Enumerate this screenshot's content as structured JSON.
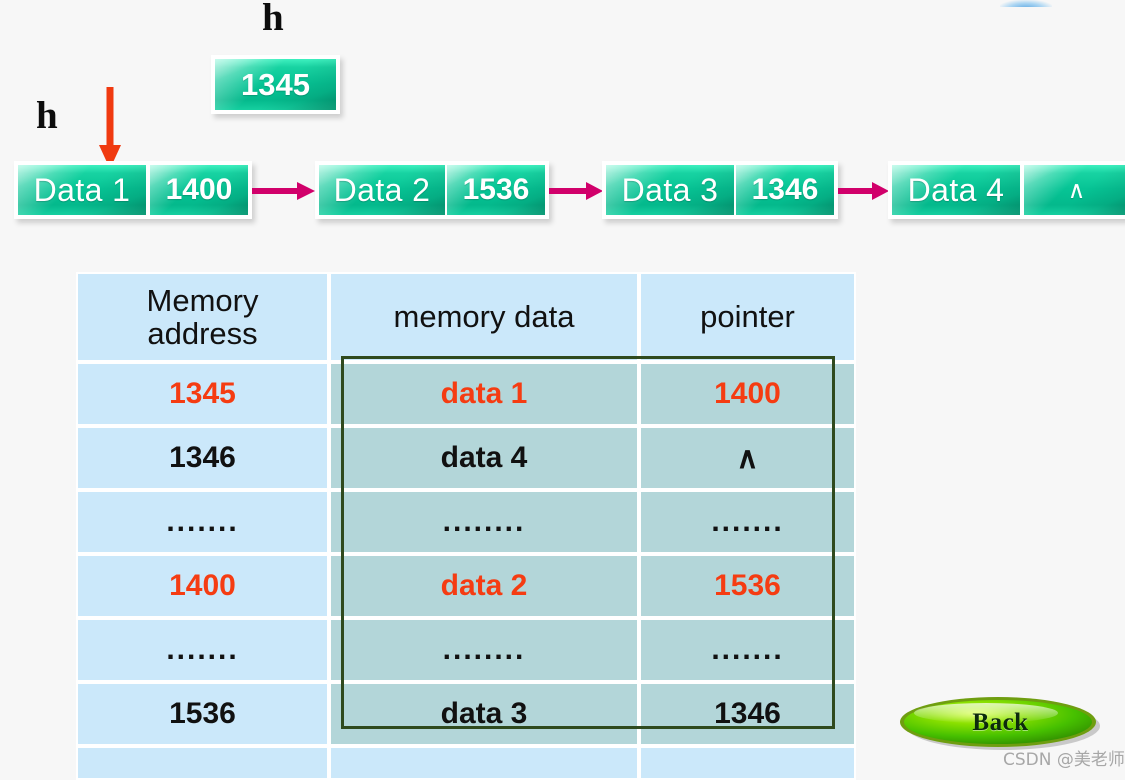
{
  "pointers": {
    "head_label_top": "h",
    "head_label_left": "h"
  },
  "head_box": {
    "value": "1345"
  },
  "linked_list": {
    "nodes": [
      {
        "data": "Data 1",
        "pointer": "1400"
      },
      {
        "data": "Data 2",
        "pointer": "1536"
      },
      {
        "data": "Data 3",
        "pointer": "1346"
      },
      {
        "data": "Data 4",
        "pointer": "∧"
      }
    ]
  },
  "table": {
    "headers": [
      "Memory address",
      "memory data",
      "pointer"
    ],
    "header_line1": "Memory",
    "header_line2": "address",
    "rows": [
      {
        "address": "1345",
        "data": "data 1",
        "pointer": "1400",
        "highlight": "red"
      },
      {
        "address": "1346",
        "data": "data 4",
        "pointer": "∧",
        "highlight": "black"
      },
      {
        "address": ".......",
        "data": "........",
        "pointer": ".......",
        "highlight": "black"
      },
      {
        "address": "1400",
        "data": "data 2",
        "pointer": "1536",
        "highlight": "red"
      },
      {
        "address": ".......",
        "data": "........",
        "pointer": ".......",
        "highlight": "black"
      },
      {
        "address": "1536",
        "data": "data 3",
        "pointer": "1346",
        "highlight": "black"
      }
    ]
  },
  "back_button": {
    "label": "Back"
  },
  "watermark": {
    "text": "CSDN @美老师"
  },
  "colors": {
    "node_teal": "#06c495",
    "arrow_magenta": "#d1006b",
    "red_arrow": "#f03a10",
    "table_blue": "#cbe8fa",
    "highlight_teal": "#b3d6d9",
    "highlight_border": "#2f4a1e",
    "red_text": "#f53c12",
    "back_green": "#4fc400"
  }
}
